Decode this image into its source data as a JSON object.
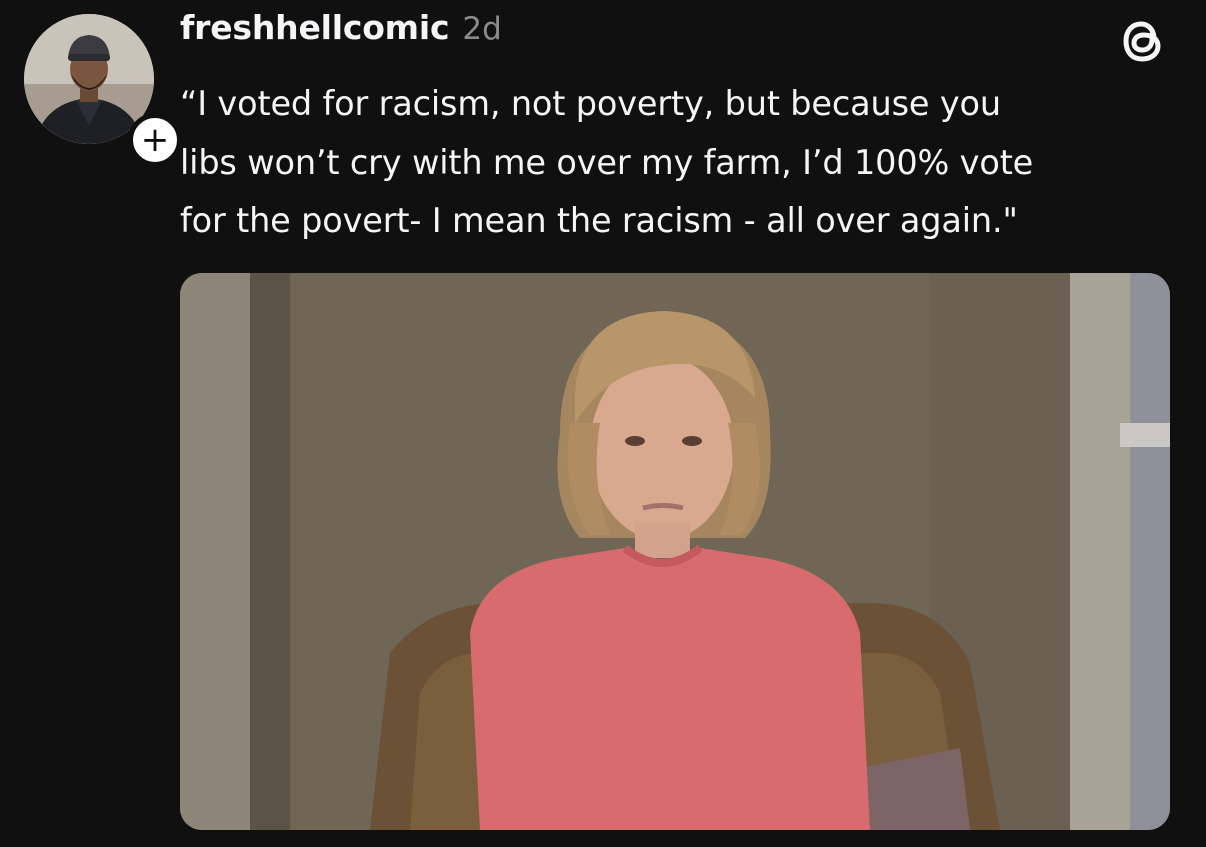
{
  "post": {
    "username": "freshhellcomic",
    "time": "2d",
    "caption": "“I voted for racism, not poverty, but because you\nlibs won’t cry with me over my farm, I’d 100% vote\nfor the povert- I mean the racism - all over again.\"",
    "follow_symbol": "+"
  },
  "icons": {
    "avatar": "profile-photo",
    "follow": "plus-icon",
    "app": "threads-logo"
  },
  "media": {
    "type": "image",
    "description_name": "woman-in-pink-sweater-still"
  },
  "colors": {
    "background": "#101010",
    "text_primary": "#f3f5f7",
    "text_secondary": "#8a8a8a",
    "sweater": "#d86b6e"
  }
}
